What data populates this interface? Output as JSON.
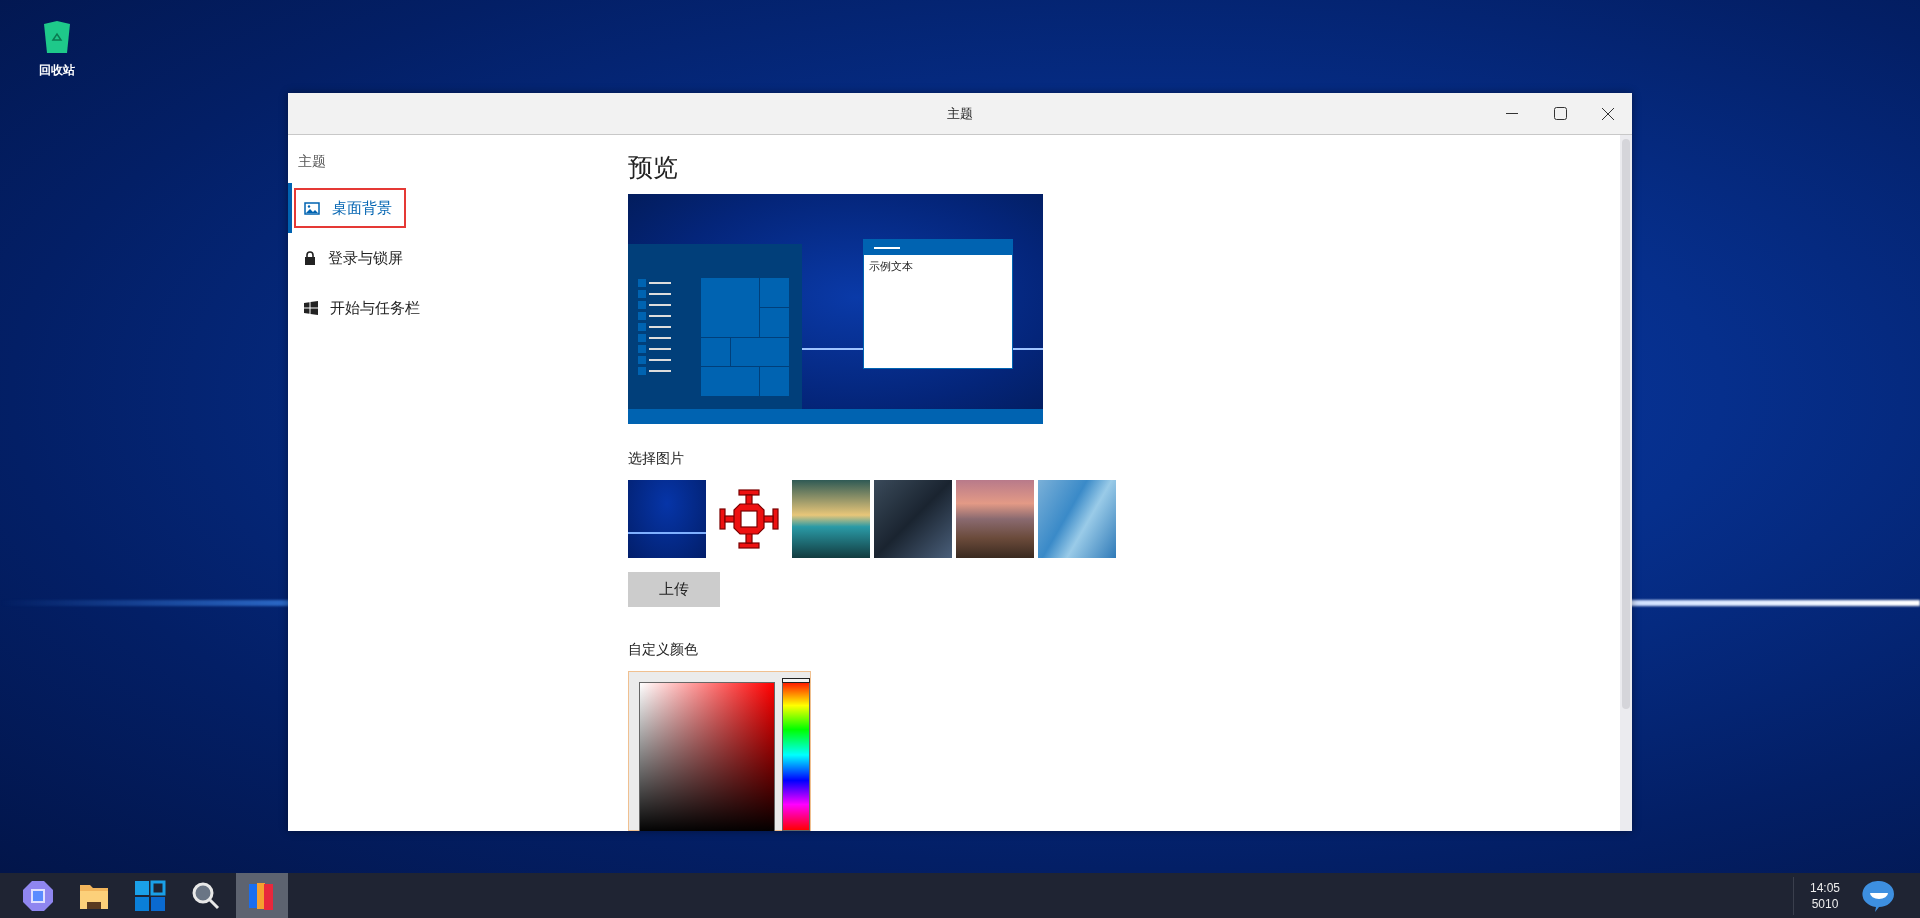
{
  "desktop_icons": [
    {
      "label": "回收站"
    }
  ],
  "window": {
    "title": "主题"
  },
  "sidebar": {
    "heading": "主题",
    "items": [
      {
        "kind": "picture",
        "label": "桌面背景",
        "selected": true,
        "outlined": true
      },
      {
        "kind": "lock",
        "label": "登录与锁屏",
        "selected": false,
        "outlined": false
      },
      {
        "kind": "windows",
        "label": "开始与任务栏",
        "selected": false,
        "outlined": false
      }
    ]
  },
  "preview": {
    "title": "预览",
    "sample_text": "示例文本"
  },
  "pictures": {
    "title": "选择图片",
    "thumbnails": [
      {
        "kind": "wallpaper"
      },
      {
        "kind": "cross"
      },
      {
        "kind": "landscape"
      },
      {
        "kind": "circuit"
      },
      {
        "kind": "mountain"
      },
      {
        "kind": "building"
      }
    ],
    "upload_button": "上传"
  },
  "custom_color": {
    "title": "自定义颜色",
    "hue": {
      "level": 0
    }
  },
  "taskbar": {
    "apps": [
      {
        "kind": "launcher",
        "selected": false
      },
      {
        "kind": "folder",
        "selected": false
      },
      {
        "kind": "start",
        "selected": false
      },
      {
        "kind": "search",
        "selected": false
      },
      {
        "kind": "books",
        "selected": true
      }
    ],
    "clock": {
      "time": "14:05",
      "date": "5010"
    }
  }
}
